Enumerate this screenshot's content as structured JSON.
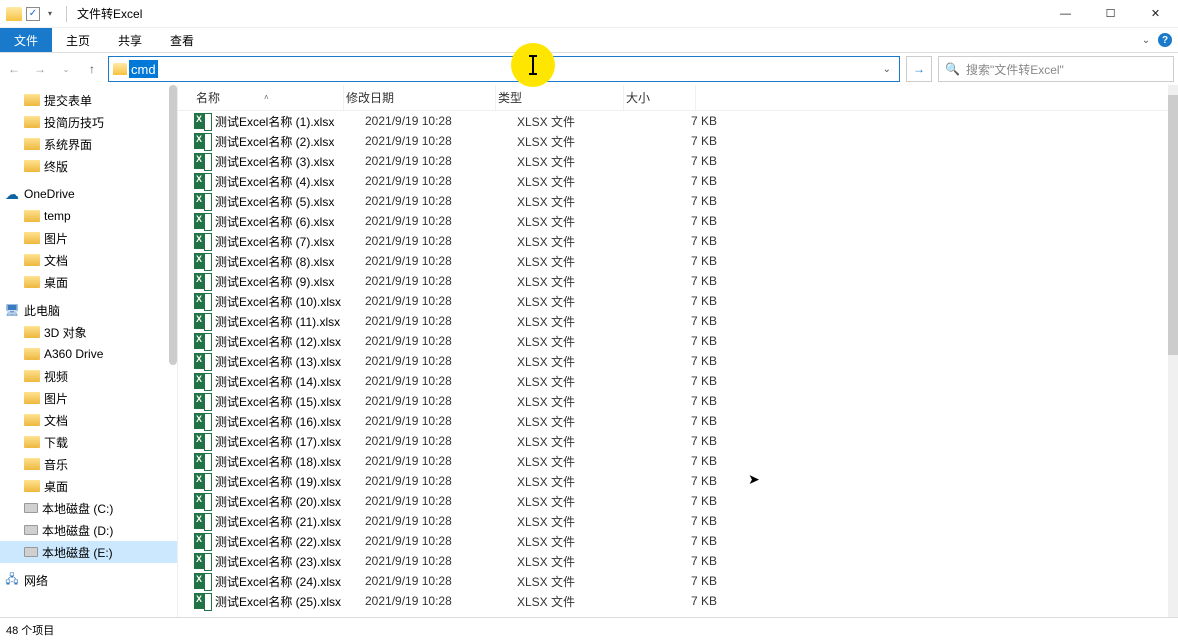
{
  "window": {
    "title": "文件转Excel",
    "check": "✓"
  },
  "ribbon": {
    "file": "文件",
    "home": "主页",
    "share": "共享",
    "view": "查看",
    "help": "?"
  },
  "address": {
    "typed": "cmd",
    "search_placeholder": "搜索\"文件转Excel\""
  },
  "sidebar": {
    "items1": [
      {
        "label": "提交表单"
      },
      {
        "label": "投简历技巧"
      },
      {
        "label": "系统界面"
      },
      {
        "label": "终版"
      }
    ],
    "onedrive": "OneDrive",
    "od_items": [
      {
        "label": "temp"
      },
      {
        "label": "图片"
      },
      {
        "label": "文档"
      },
      {
        "label": "桌面"
      }
    ],
    "thispc": "此电脑",
    "pc_items": [
      {
        "label": "3D 对象"
      },
      {
        "label": "A360 Drive"
      },
      {
        "label": "视频"
      },
      {
        "label": "图片"
      },
      {
        "label": "文档"
      },
      {
        "label": "下载"
      },
      {
        "label": "音乐"
      },
      {
        "label": "桌面"
      },
      {
        "label": "本地磁盘 (C:)"
      },
      {
        "label": "本地磁盘 (D:)"
      },
      {
        "label": "本地磁盘 (E:)",
        "selected": true
      }
    ],
    "network": "网络"
  },
  "columns": {
    "name": "名称",
    "date": "修改日期",
    "type": "类型",
    "size": "大小"
  },
  "files": [
    {
      "name": "测试Excel名称 (1).xlsx",
      "date": "2021/9/19 10:28",
      "type": "XLSX 文件",
      "size": "7 KB"
    },
    {
      "name": "测试Excel名称 (2).xlsx",
      "date": "2021/9/19 10:28",
      "type": "XLSX 文件",
      "size": "7 KB"
    },
    {
      "name": "测试Excel名称 (3).xlsx",
      "date": "2021/9/19 10:28",
      "type": "XLSX 文件",
      "size": "7 KB"
    },
    {
      "name": "测试Excel名称 (4).xlsx",
      "date": "2021/9/19 10:28",
      "type": "XLSX 文件",
      "size": "7 KB"
    },
    {
      "name": "测试Excel名称 (5).xlsx",
      "date": "2021/9/19 10:28",
      "type": "XLSX 文件",
      "size": "7 KB"
    },
    {
      "name": "测试Excel名称 (6).xlsx",
      "date": "2021/9/19 10:28",
      "type": "XLSX 文件",
      "size": "7 KB"
    },
    {
      "name": "测试Excel名称 (7).xlsx",
      "date": "2021/9/19 10:28",
      "type": "XLSX 文件",
      "size": "7 KB"
    },
    {
      "name": "测试Excel名称 (8).xlsx",
      "date": "2021/9/19 10:28",
      "type": "XLSX 文件",
      "size": "7 KB"
    },
    {
      "name": "测试Excel名称 (9).xlsx",
      "date": "2021/9/19 10:28",
      "type": "XLSX 文件",
      "size": "7 KB"
    },
    {
      "name": "测试Excel名称 (10).xlsx",
      "date": "2021/9/19 10:28",
      "type": "XLSX 文件",
      "size": "7 KB"
    },
    {
      "name": "测试Excel名称 (11).xlsx",
      "date": "2021/9/19 10:28",
      "type": "XLSX 文件",
      "size": "7 KB"
    },
    {
      "name": "测试Excel名称 (12).xlsx",
      "date": "2021/9/19 10:28",
      "type": "XLSX 文件",
      "size": "7 KB"
    },
    {
      "name": "测试Excel名称 (13).xlsx",
      "date": "2021/9/19 10:28",
      "type": "XLSX 文件",
      "size": "7 KB"
    },
    {
      "name": "测试Excel名称 (14).xlsx",
      "date": "2021/9/19 10:28",
      "type": "XLSX 文件",
      "size": "7 KB"
    },
    {
      "name": "测试Excel名称 (15).xlsx",
      "date": "2021/9/19 10:28",
      "type": "XLSX 文件",
      "size": "7 KB"
    },
    {
      "name": "测试Excel名称 (16).xlsx",
      "date": "2021/9/19 10:28",
      "type": "XLSX 文件",
      "size": "7 KB"
    },
    {
      "name": "测试Excel名称 (17).xlsx",
      "date": "2021/9/19 10:28",
      "type": "XLSX 文件",
      "size": "7 KB"
    },
    {
      "name": "测试Excel名称 (18).xlsx",
      "date": "2021/9/19 10:28",
      "type": "XLSX 文件",
      "size": "7 KB"
    },
    {
      "name": "测试Excel名称 (19).xlsx",
      "date": "2021/9/19 10:28",
      "type": "XLSX 文件",
      "size": "7 KB"
    },
    {
      "name": "测试Excel名称 (20).xlsx",
      "date": "2021/9/19 10:28",
      "type": "XLSX 文件",
      "size": "7 KB"
    },
    {
      "name": "测试Excel名称 (21).xlsx",
      "date": "2021/9/19 10:28",
      "type": "XLSX 文件",
      "size": "7 KB"
    },
    {
      "name": "测试Excel名称 (22).xlsx",
      "date": "2021/9/19 10:28",
      "type": "XLSX 文件",
      "size": "7 KB"
    },
    {
      "name": "测试Excel名称 (23).xlsx",
      "date": "2021/9/19 10:28",
      "type": "XLSX 文件",
      "size": "7 KB"
    },
    {
      "name": "测试Excel名称 (24).xlsx",
      "date": "2021/9/19 10:28",
      "type": "XLSX 文件",
      "size": "7 KB"
    },
    {
      "name": "测试Excel名称 (25).xlsx",
      "date": "2021/9/19 10:28",
      "type": "XLSX 文件",
      "size": "7 KB"
    }
  ],
  "status": {
    "count": "48 个项目"
  }
}
